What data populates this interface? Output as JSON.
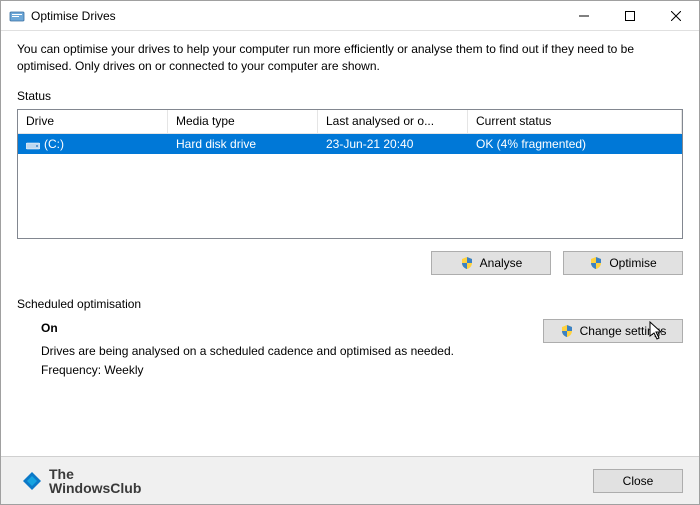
{
  "window": {
    "title": "Optimise Drives"
  },
  "description": "You can optimise your drives to help your computer run more efficiently or analyse them to find out if they need to be optimised. Only drives on or connected to your computer are shown.",
  "status_label": "Status",
  "table": {
    "headers": {
      "drive": "Drive",
      "media": "Media type",
      "last": "Last analysed or o...",
      "status": "Current status"
    },
    "rows": [
      {
        "drive": "(C:)",
        "media": "Hard disk drive",
        "last": "23-Jun-21 20:40",
        "status": "OK (4% fragmented)"
      }
    ]
  },
  "buttons": {
    "analyse": "Analyse",
    "optimise": "Optimise",
    "change_settings": "Change settings",
    "close": "Close"
  },
  "scheduled": {
    "label": "Scheduled optimisation",
    "state": "On",
    "desc": "Drives are being analysed on a scheduled cadence and optimised as needed.",
    "frequency": "Frequency: Weekly"
  },
  "watermark": {
    "line1": "The",
    "line2": "WindowsClub"
  }
}
